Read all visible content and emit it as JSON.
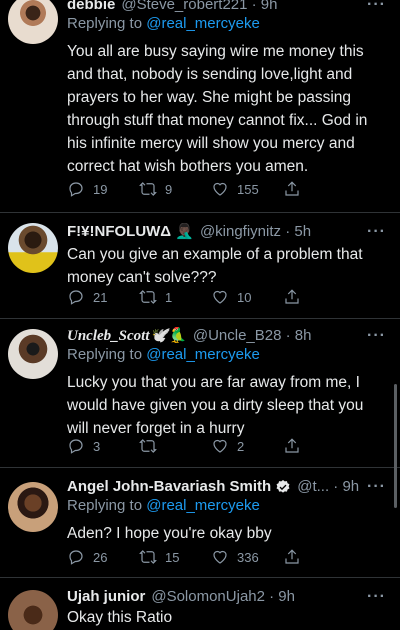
{
  "tweets": [
    {
      "name": "debbie",
      "handle": "@Steve_robert221 · 9h",
      "replying_prefix": "Replying to ",
      "replying_to": "@real_mercyeke",
      "text": "You all are busy saying wire me money this and that, nobody is sending love,light and prayers to her way. She might be passing through stuff that money cannot fix... God in his infinite mercy will show you mercy and correct hat wish bothers you amen.",
      "replies": "19",
      "retweets": "9",
      "likes": "155"
    },
    {
      "name": "F!¥!NFOLUWΔ 🤦🏿‍♂️",
      "handle": "@kingfiynitz · 5h",
      "text": "Can you give an example of a problem that money can't solve???",
      "replies": "21",
      "retweets": "1",
      "likes": "10"
    },
    {
      "name": "Uncleb_Scott🕊️🦜",
      "handle": "@Uncle_B28 · 8h",
      "replying_prefix": "Replying to ",
      "replying_to": "@real_mercyeke",
      "text": "Lucky you that you are far away from me, I would have given you a dirty sleep that you will never forget in a hurry",
      "replies": "3",
      "retweets": "",
      "likes": "2"
    },
    {
      "name": "Angel John-Bavariash Smith",
      "handle": "@t... · 9h",
      "replying_prefix": "Replying to ",
      "replying_to": "@real_mercyeke",
      "text": "Aden? I hope you're okay bby",
      "replies": "26",
      "retweets": "15",
      "likes": "336"
    },
    {
      "name": "Ujah junior",
      "handle": "@SolomonUjah2 · 9h",
      "text": "Okay this Ratio"
    }
  ],
  "more_label": "···",
  "colors": {
    "background": "#000000",
    "text": "#e7e9ea",
    "muted": "#8b98a5",
    "link": "#1d9bf0",
    "verified": "#1d9bf0"
  }
}
